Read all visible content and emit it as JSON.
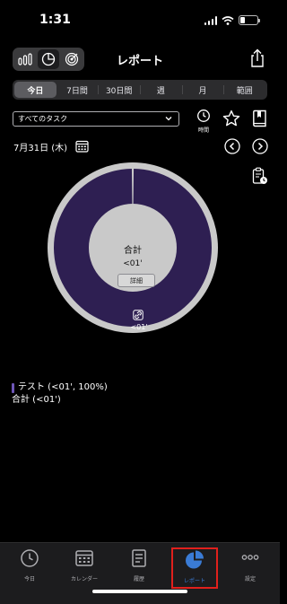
{
  "status": {
    "time": "1:31"
  },
  "nav": {
    "title": "レポート"
  },
  "period_tabs": [
    {
      "label": "今日",
      "active": true
    },
    {
      "label": "7日間",
      "active": false
    },
    {
      "label": "30日間",
      "active": false
    },
    {
      "label": "週",
      "active": false
    },
    {
      "label": "月",
      "active": false
    },
    {
      "label": "範囲",
      "active": false
    }
  ],
  "filter": {
    "task_select_value": "すべてのタスク",
    "time_button_label": "時間"
  },
  "date": {
    "label": "7月31日 (木)"
  },
  "chart_data": {
    "type": "pie",
    "center_title": "合計",
    "center_value": "<01'",
    "detail_button": "詳細",
    "slices": [
      {
        "name": "テスト",
        "value": 100,
        "label": "<01'",
        "color": "#2e1f52"
      }
    ]
  },
  "legend": {
    "items": [
      {
        "text": "テスト (<01', 100%)",
        "color": "#6e56b8"
      }
    ],
    "total": "合計 (<01')"
  },
  "tab_bar": {
    "items": [
      {
        "label": "今日",
        "icon": "clock-icon"
      },
      {
        "label": "カレンダー",
        "icon": "calendar-icon"
      },
      {
        "label": "履歴",
        "icon": "history-icon"
      },
      {
        "label": "レポート",
        "icon": "pie-chart-icon",
        "active": true
      },
      {
        "label": "設定",
        "icon": "more-icon"
      }
    ]
  },
  "colors": {
    "accent": "#3a7bd5",
    "highlight": "#e0201c",
    "slice": "#2e1f52",
    "ring": "#c9c9c9"
  }
}
